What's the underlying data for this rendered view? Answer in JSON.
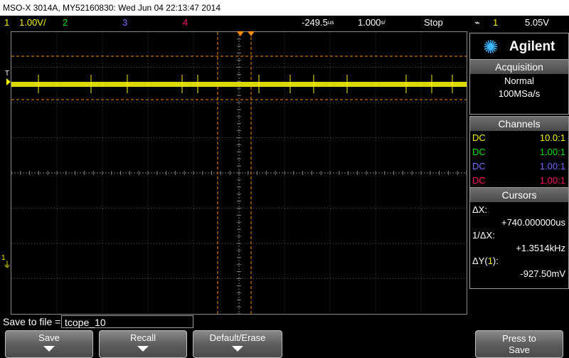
{
  "title_bar": "MSO-X 3014A, MY52160830: Wed Jun 04 22:13:47 2014",
  "status": {
    "ch1_num": "1",
    "ch1_scale": "1.00V/",
    "ch2_num": "2",
    "ch3_num": "3",
    "ch4_num": "4",
    "time_delay": "-249.5",
    "time_delay_unit": "us",
    "time_scale": "1.000",
    "time_scale_unit": "s/",
    "run_state": "Stop",
    "trigger_icon": "⌁",
    "trigger_ch": "1",
    "trigger_level": "5.05V"
  },
  "markers": {
    "trigger_T": "T",
    "ch1_ground": "1"
  },
  "brand": {
    "name": "Agilent"
  },
  "acquisition": {
    "header": "Acquisition",
    "mode": "Normal",
    "rate": "100MSa/s"
  },
  "channels": {
    "header": "Channels",
    "rows": [
      {
        "coupling": "DC",
        "probe": "10.0:1",
        "color": "#f5f000"
      },
      {
        "coupling": "DC",
        "probe": "1.00:1",
        "color": "#00e000"
      },
      {
        "coupling": "DC",
        "probe": "1.00:1",
        "color": "#6f6cff"
      },
      {
        "coupling": "DC",
        "probe": "1.00:1",
        "color": "#ff1070"
      }
    ]
  },
  "cursors": {
    "header": "Cursors",
    "dx_label": "ΔX:",
    "dx_value": "+740.000000us",
    "inv_dx_label": "1/ΔX:",
    "inv_dx_value": "+1.3514kHz",
    "dy_label_prefix": "ΔY(",
    "dy_channel": "1",
    "dy_label_suffix": "):",
    "dy_value": "-927.50mV"
  },
  "save": {
    "label": "Save to file =",
    "filename": "tcope_10"
  },
  "softkeys": {
    "save": "Save",
    "recall": "Recall",
    "default_erase": "Default/Erase",
    "press_to": "Press to",
    "save_action": "Save"
  },
  "colors": {
    "ch1": "#f5f000",
    "ch2": "#00e000",
    "ch3": "#6f6cff",
    "ch4": "#ff1070",
    "cursor": "#ff8c00",
    "grid": "#5a5a5a"
  }
}
